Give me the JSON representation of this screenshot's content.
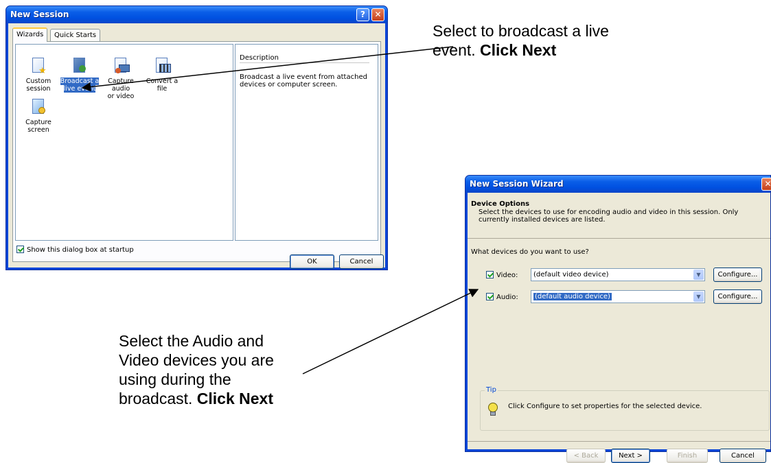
{
  "dialog1": {
    "title": "New Session",
    "tabs": [
      "Wizards",
      "Quick Starts"
    ],
    "wizards": [
      {
        "label_line1": "Custom",
        "label_line2": "session",
        "icon": "custom-session-icon"
      },
      {
        "label_line1": "Broadcast a",
        "label_line2": "live event",
        "icon": "broadcast-icon",
        "selected": true
      },
      {
        "label_line1": "Capture audio",
        "label_line2": "or video",
        "icon": "capture-av-icon"
      },
      {
        "label_line1": "Convert a file",
        "label_line2": "",
        "icon": "convert-file-icon"
      },
      {
        "label_line1": "Capture",
        "label_line2": "screen",
        "icon": "capture-screen-icon"
      }
    ],
    "description_heading": "Description",
    "description_text": "Broadcast a live event from attached devices or computer screen.",
    "startup_checkbox": "Show this dialog box at startup",
    "startup_checked": true,
    "ok_label": "OK",
    "cancel_label": "Cancel"
  },
  "dialog2": {
    "title": "New Session Wizard",
    "section_title": "Device Options",
    "section_desc": "Select the devices to use for encoding audio and video in this session. Only currently installed devices are listed.",
    "question": "What devices do you want to use?",
    "video_label": "Video:",
    "video_checked": true,
    "video_device": "(default video device)",
    "audio_label": "Audio:",
    "audio_checked": true,
    "audio_device": "(default audio device)",
    "configure_label": "Configure...",
    "tip_heading": "Tip",
    "tip_text": "Click Configure to set properties for the selected device.",
    "back_label": "< Back",
    "next_label": "Next >",
    "finish_label": "Finish",
    "cancel_label": "Cancel"
  },
  "annotations": {
    "top_text": "Select to broadcast a live event.",
    "top_bold": "Click Next",
    "bottom_text_1": "Select the Audio and",
    "bottom_text_2": "Video devices you are",
    "bottom_text_3": "using during the",
    "bottom_text_4": "broadcast.",
    "bottom_bold": "Click Next"
  },
  "colors": {
    "title_bar": "#0a5ee8",
    "dialog_face": "#ece9d8",
    "selection": "#316ac5",
    "checkmark": "#21a121"
  }
}
